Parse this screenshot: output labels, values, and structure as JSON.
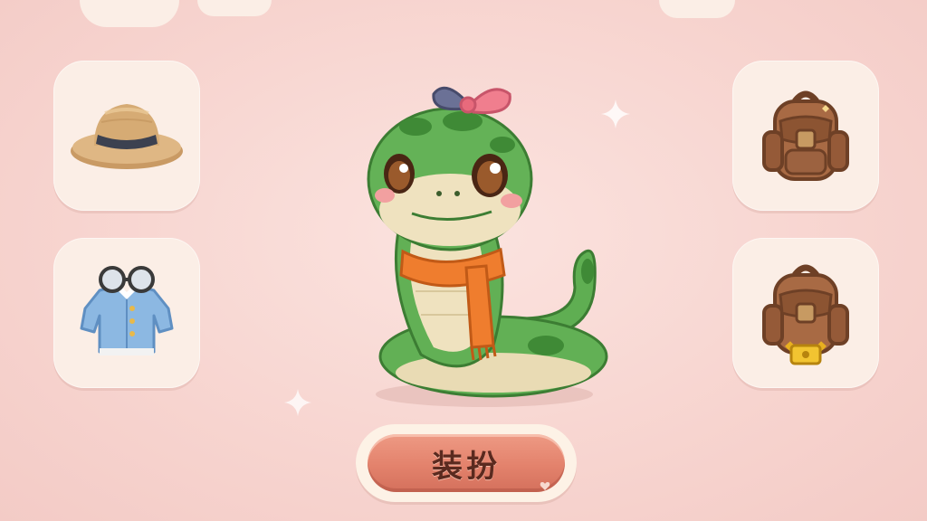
{
  "dress_up_button": {
    "label": "装扮"
  },
  "left_slots": [
    {
      "icon": "straw-hat-icon"
    },
    {
      "icon": "blue-shirt-glasses-icon"
    }
  ],
  "right_slots": [
    {
      "icon": "brown-backpack-icon"
    },
    {
      "icon": "brown-backpack-gold-clasp-icon"
    }
  ],
  "colors": {
    "background": "#f7d4cf",
    "slot": "#fbeee6",
    "button": "#e3826c",
    "button_text": "#5a2a1f"
  }
}
